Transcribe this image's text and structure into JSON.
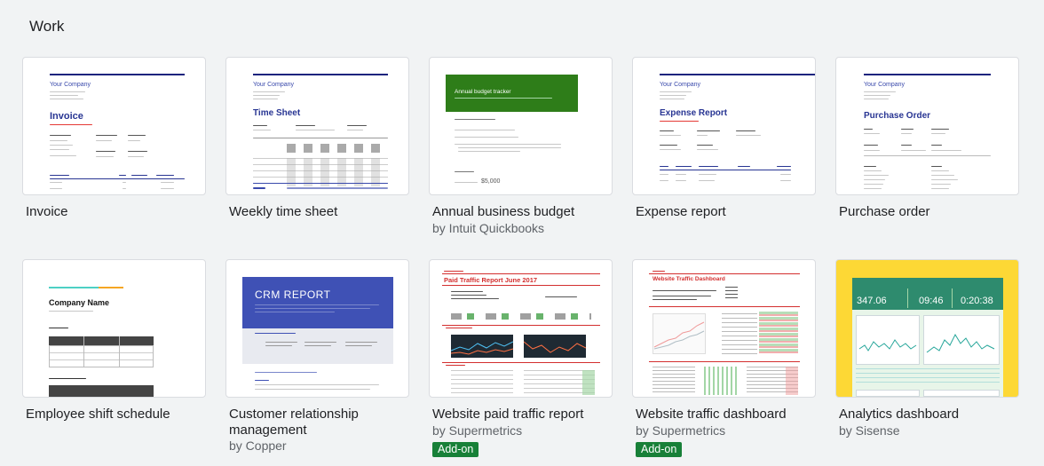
{
  "section": {
    "title": "Work"
  },
  "templates": [
    {
      "name": "Invoice",
      "company": "Your Company",
      "heading": "Invoice"
    },
    {
      "name": "Weekly time sheet",
      "company": "Your Company",
      "heading": "Time Sheet"
    },
    {
      "name": "Annual business budget",
      "by": "by Intuit Quickbooks",
      "heading": "Annual budget tracker",
      "amount": "$5,000"
    },
    {
      "name": "Expense report",
      "company": "Your Company",
      "heading": "Expense Report"
    },
    {
      "name": "Purchase order",
      "company": "Your Company",
      "heading": "Purchase Order"
    },
    {
      "name": "Employee shift schedule",
      "heading": "Company Name"
    },
    {
      "name_line1": "Customer relationship",
      "name_line2": "management",
      "by": "by Copper",
      "heading": "CRM REPORT"
    },
    {
      "name": "Website paid traffic report",
      "by": "by Supermetrics",
      "badge": "Add-on",
      "heading": "Paid Traffic Report June 2017"
    },
    {
      "name": "Website traffic dashboard",
      "by": "by Supermetrics",
      "badge": "Add-on",
      "heading": "Website Traffic Dashboard"
    },
    {
      "name": "Analytics dashboard",
      "by": "by Sisense",
      "stats": [
        "347.06",
        "09:46",
        "0:20:38"
      ]
    }
  ],
  "colors": {
    "accent": "#1a73e8",
    "navy": "#1a237e",
    "green": "#2e7d19",
    "addon": "#188038",
    "red": "#d32f2f",
    "teal": "#2e8b6e"
  }
}
